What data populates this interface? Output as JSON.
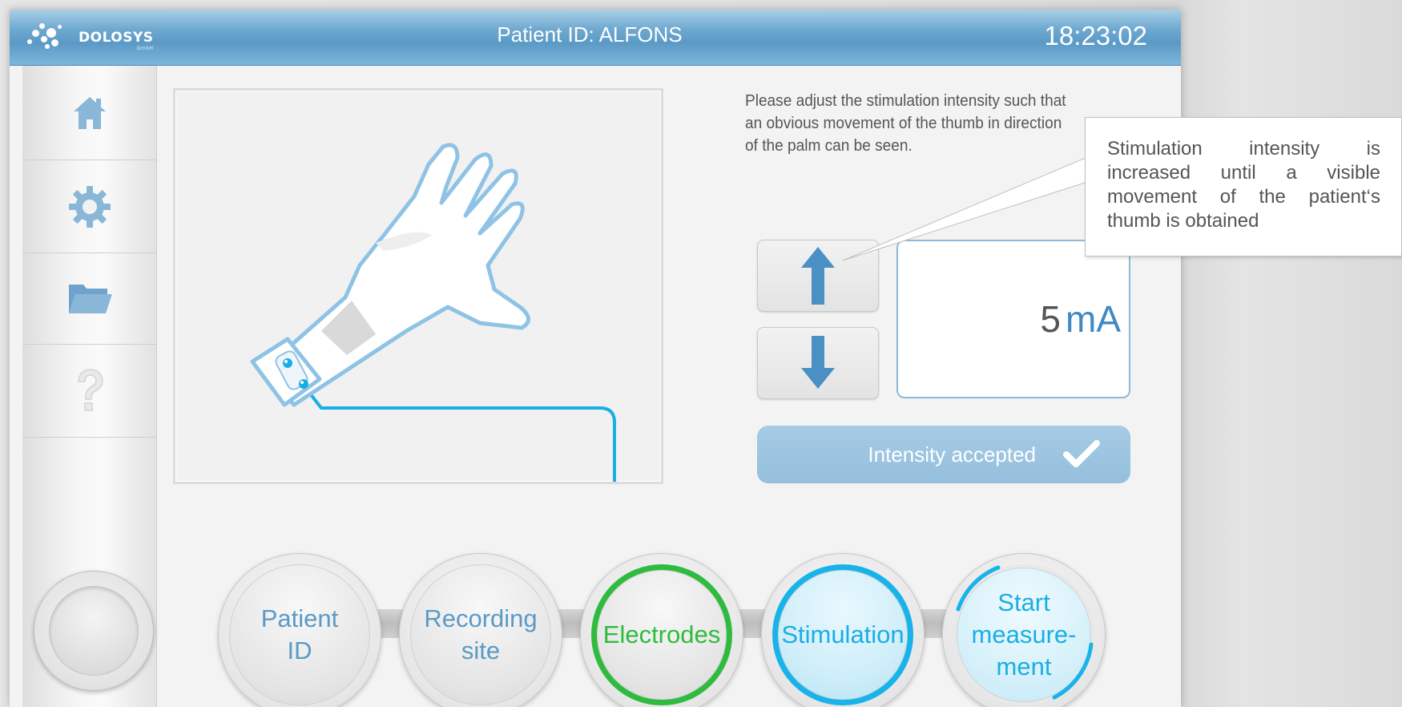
{
  "header": {
    "logo_text": "DOLOSYS",
    "logo_sub": "GmbH",
    "title": "Patient ID: ALFONS",
    "clock": "18:23:02"
  },
  "sidebar": {
    "items": [
      {
        "name": "home",
        "icon": "home-icon"
      },
      {
        "name": "settings",
        "icon": "gear-icon"
      },
      {
        "name": "files",
        "icon": "folder-icon"
      },
      {
        "name": "help",
        "icon": "help-icon"
      }
    ],
    "power_button": "power-button"
  },
  "instruction": "Please adjust the stimulation intensity such that an obvious movement of the thumb in direction of the palm can be seen.",
  "intensity": {
    "value": "5",
    "unit": "mA"
  },
  "accept_button": {
    "label": "Intensity accepted",
    "icon": "checkmark-icon"
  },
  "callout": "Stimulation intensity is increased until a visible movement of the patient‘s thumb is obtained",
  "steps": [
    {
      "label_line1": "Patient",
      "label_line2": "ID",
      "state": "default"
    },
    {
      "label_line1": "Recording",
      "label_line2": "site",
      "state": "default"
    },
    {
      "label_line1": "Electrodes",
      "label_line2": "",
      "state": "done"
    },
    {
      "label_line1": "Stimulation",
      "label_line2": "",
      "state": "active"
    },
    {
      "label_line1": "Start",
      "label_line2": "measure-",
      "label_line3": "ment",
      "state": "next"
    }
  ],
  "colors": {
    "accent_blue": "#5b9ac6",
    "step_done": "#2fbb3f",
    "step_active": "#17b3ea",
    "accept_bg": "#9bc4e0"
  }
}
